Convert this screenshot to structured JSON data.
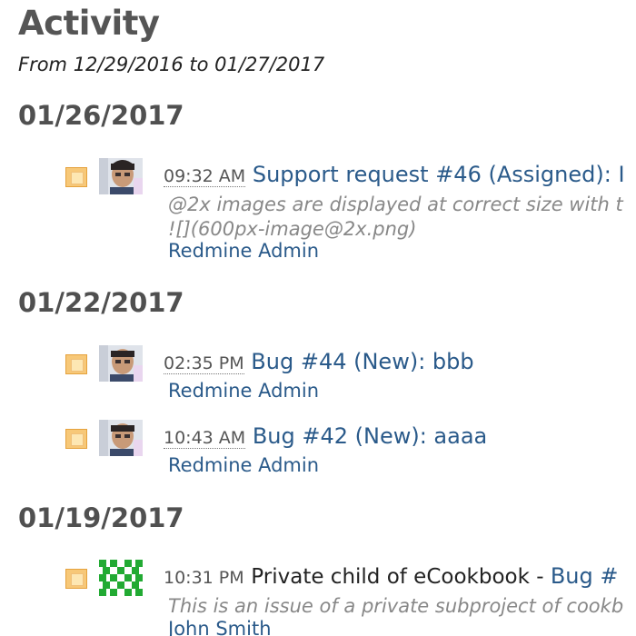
{
  "page": {
    "title": "Activity",
    "date_range": "From 12/29/2016 to 01/27/2017"
  },
  "days": [
    {
      "date": "01/26/2017",
      "events": [
        {
          "time": "09:32 AM",
          "title": "Support request #46 (Assigned): I",
          "description_line1": "@2x images are displayed at correct size with t",
          "description_line2": "![](600px-image@2x.png)",
          "author": "Redmine Admin",
          "icon": "issue-icon",
          "avatar": "photo-avatar"
        }
      ]
    },
    {
      "date": "01/22/2017",
      "events": [
        {
          "time": "02:35 PM",
          "title": "Bug #44 (New): bbb",
          "author": "Redmine Admin",
          "icon": "issue-icon",
          "avatar": "photo-avatar"
        },
        {
          "time": "10:43 AM",
          "title": "Bug #42 (New): aaaa",
          "author": "Redmine Admin",
          "icon": "issue-icon",
          "avatar": "photo-avatar"
        }
      ]
    },
    {
      "date": "01/19/2017",
      "events": [
        {
          "time": "10:31 PM",
          "project": "Private child of eCookbook - ",
          "title": "Bug #",
          "description_line1": "This is an issue of a private subproject of cookb",
          "author": "John Smith",
          "icon": "issue-icon",
          "avatar": "identicon-avatar"
        }
      ]
    }
  ],
  "colors": {
    "link": "#2a5a8a",
    "heading": "#505050",
    "description": "#888888",
    "icon_fill": "#f7c878",
    "identicon": "#22aa33"
  }
}
